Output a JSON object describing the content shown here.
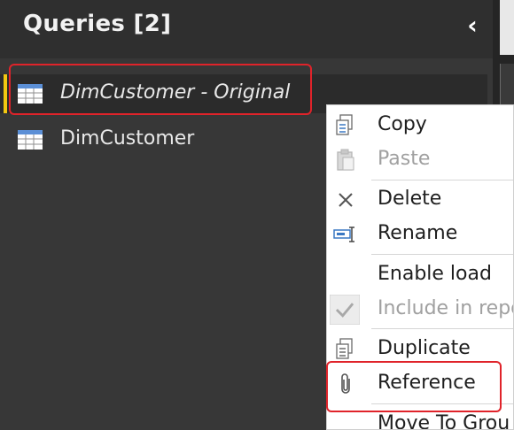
{
  "pane": {
    "title": "Queries [2]",
    "collapse_icon": "chevron-left-icon"
  },
  "queries": [
    {
      "label": "DimCustomer - Original",
      "selected": true,
      "icon": "table-icon"
    },
    {
      "label": "DimCustomer",
      "selected": false,
      "icon": "table-icon"
    }
  ],
  "context_menu": {
    "items": [
      {
        "label": "Copy",
        "icon": "copy-icon",
        "enabled": true
      },
      {
        "label": "Paste",
        "icon": "paste-icon",
        "enabled": false
      },
      {
        "label": "Delete",
        "icon": "delete-icon",
        "enabled": true
      },
      {
        "label": "Rename",
        "icon": "rename-icon",
        "enabled": true
      },
      {
        "label": "Enable load",
        "icon": "",
        "enabled": true
      },
      {
        "label": "Include in repo",
        "icon": "checkmark-icon",
        "enabled": false
      },
      {
        "label": "Duplicate",
        "icon": "duplicate-icon",
        "enabled": true
      },
      {
        "label": "Reference",
        "icon": "paperclip-icon",
        "enabled": true
      },
      {
        "label": "Move To Grou",
        "icon": "",
        "enabled": true
      }
    ]
  },
  "colors": {
    "accent": "#f2c811",
    "highlight": "#e0232a",
    "pane_bg": "#373737"
  }
}
